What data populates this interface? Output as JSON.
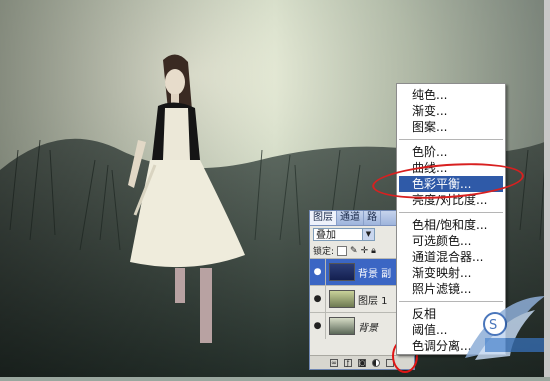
{
  "layers_panel": {
    "tabs": [
      "图层",
      "通道",
      "路"
    ],
    "blend_mode": "叠加",
    "lock_label": "锁定:",
    "layers": [
      {
        "name": "背景 副",
        "selected": true,
        "italic": false
      },
      {
        "name": "图层 1",
        "selected": false,
        "italic": false
      },
      {
        "name": "背景",
        "selected": false,
        "italic": true
      }
    ]
  },
  "menu": {
    "group1": [
      "纯色...",
      "渐变...",
      "图案..."
    ],
    "group2": [
      "色阶...",
      "曲线...",
      "色彩平衡...",
      "亮度/对比度..."
    ],
    "group3": [
      "色相/饱和度...",
      "可选颜色...",
      "通道混合器...",
      "渐变映射...",
      "照片滤镜..."
    ],
    "group4": [
      "反相",
      "阈值...",
      "色调分离..."
    ],
    "highlighted": "色彩平衡..."
  },
  "colors": {
    "highlight": "#2f5aa8",
    "annotation": "#d82020"
  }
}
